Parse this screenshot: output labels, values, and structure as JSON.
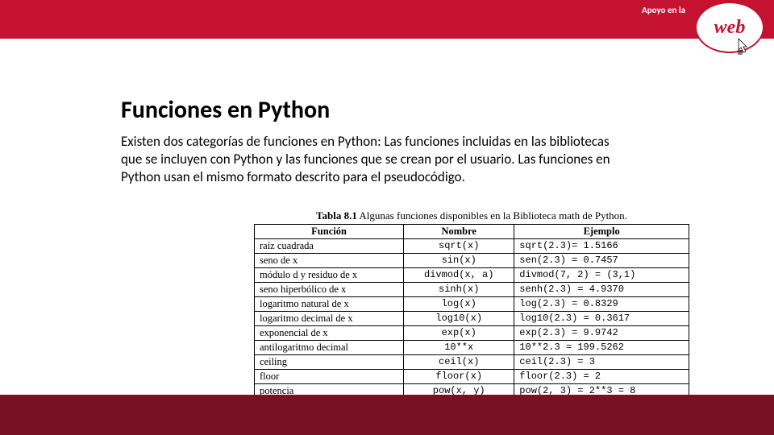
{
  "header": {
    "support_label": "Apoyo en la",
    "logo_text": "web"
  },
  "main": {
    "title": "Funciones en Python",
    "paragraph": "Existen dos categorías de funciones en Python: Las funciones incluidas en las bibliotecas que se incluyen con Python y las funciones que se crean por el usuario. Las funciones en Python usan el mismo formato descrito para el pseudocódigo."
  },
  "table": {
    "caption_bold": "Tabla 8.1",
    "caption_rest": " Algunas funciones disponibles en la Biblioteca math de Python.",
    "headers": [
      "Función",
      "Nombre",
      "Ejemplo"
    ],
    "rows": [
      {
        "funcion": "raíz cuadrada",
        "nombre": "sqrt(x)",
        "ejemplo": "sqrt(2.3)= 1.5166"
      },
      {
        "funcion": "seno de x",
        "nombre": "sin(x)",
        "ejemplo": "sen(2.3) = 0.7457"
      },
      {
        "funcion": "módulo d y residuo de x",
        "nombre": "divmod(x, a)",
        "ejemplo": "divmod(7, 2) = (3,1)"
      },
      {
        "funcion": "seno hiperbólico de x",
        "nombre": "sinh(x)",
        "ejemplo": "senh(2.3) = 4.9370"
      },
      {
        "funcion": "logaritmo natural de x",
        "nombre": "log(x)",
        "ejemplo": "log(2.3) = 0.8329"
      },
      {
        "funcion": "logaritmo decimal de x",
        "nombre": "log10(x)",
        "ejemplo": "log10(2.3) = 0.3617"
      },
      {
        "funcion": "exponencial de x",
        "nombre": "exp(x)",
        "ejemplo": "exp(2.3) = 9.9742"
      },
      {
        "funcion": "antilogaritmo decimal",
        "nombre": "10**x",
        "ejemplo": "10**2.3 = 199.5262"
      },
      {
        "funcion": "ceiling",
        "nombre": "ceil(x)",
        "ejemplo": "ceil(2.3) = 3"
      },
      {
        "funcion": "floor",
        "nombre": "floor(x)",
        "ejemplo": "floor(2.3) = 2"
      },
      {
        "funcion": "potencia",
        "nombre": "pow(x, y)",
        "ejemplo": "pow(2, 3) = 2**3 = 8"
      }
    ]
  }
}
